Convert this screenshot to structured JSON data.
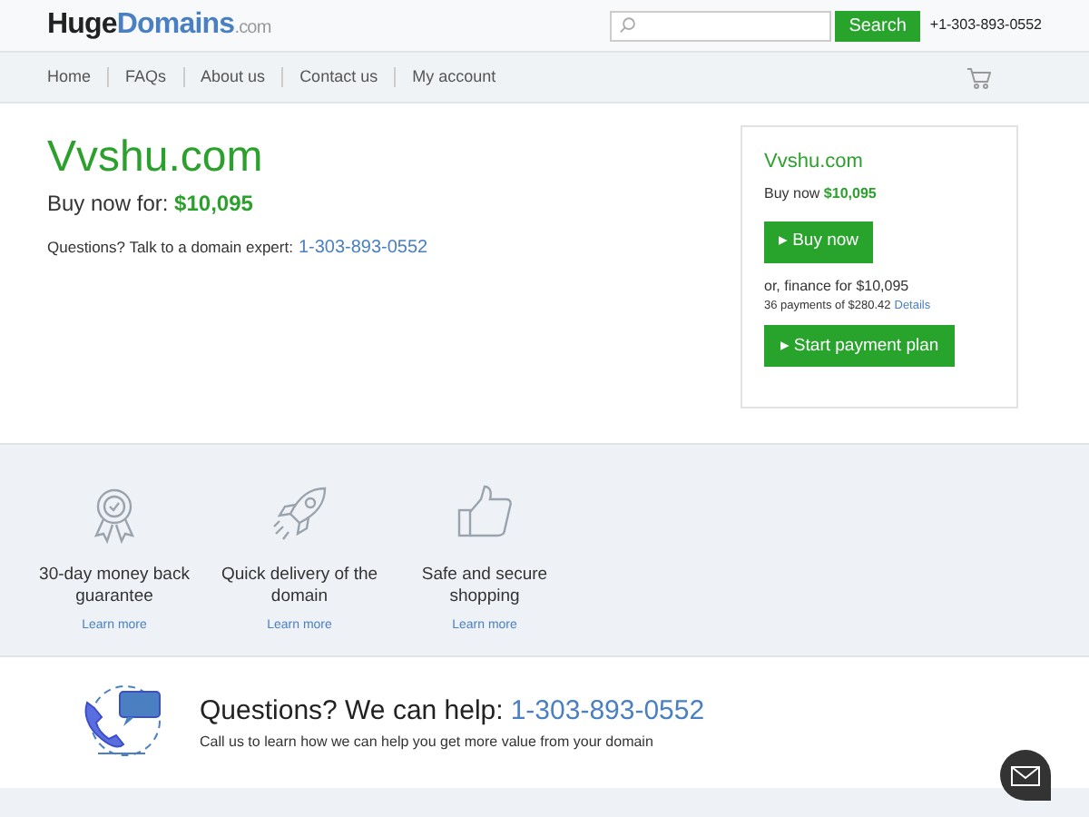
{
  "logo": {
    "part_1": "Huge",
    "part_2": "Domains",
    "part_3": ".com"
  },
  "search": {
    "button": "Search"
  },
  "phone": "+1-303-893-0552",
  "nav": [
    "Home",
    "FAQs",
    "About us",
    "Contact us",
    "My account"
  ],
  "domain": {
    "name": "Vvshu.com",
    "buy_label": "Buy now for:",
    "price": "$10,095",
    "question": "Questions? Talk to a domain expert:",
    "phone": "1-303-893-0552"
  },
  "card": {
    "name": "Vvshu.com",
    "buy_label": "Buy now",
    "price": "$10,095",
    "buy_button": "▸ Buy now",
    "finance": "or, finance for $10,095",
    "payments": "36 payments of $280.42",
    "details": "Details",
    "plan_button": "▸ Start payment plan"
  },
  "features": [
    {
      "kind": "ribbon",
      "title": "30-day money back guarantee",
      "link": "Learn more"
    },
    {
      "kind": "rocket",
      "title": "Quick delivery of the domain",
      "link": "Learn more"
    },
    {
      "kind": "thumb",
      "title": "Safe and secure shopping",
      "link": "Learn more"
    }
  ],
  "help": {
    "title": "Questions? We can help:",
    "phone": "1-303-893-0552",
    "subtitle": "Call us to learn how we can help you get more value from your domain"
  }
}
